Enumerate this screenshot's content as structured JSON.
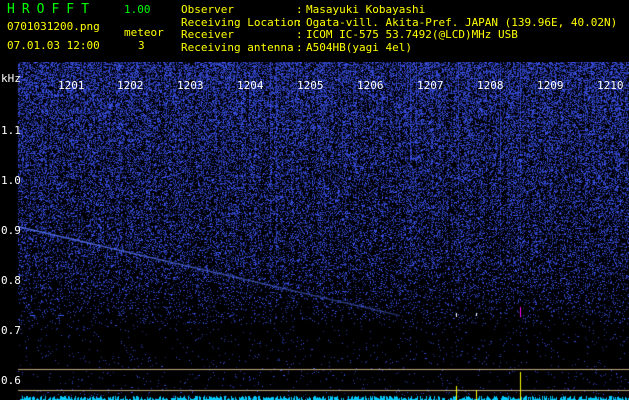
{
  "header": {
    "app_name": "HROFFT",
    "version": "1.00",
    "file_name": "0701031200.png",
    "datetime": "07.01.03 12:00",
    "meteor_label": "meteor",
    "meteor_count": "3"
  },
  "info": {
    "rows": [
      {
        "label": "Observer",
        "value": "Masayuki Kobayashi"
      },
      {
        "label": "Receiving Location",
        "value": "Ogata-vill. Akita-Pref. JAPAN (139.96E, 40.02N)"
      },
      {
        "label": "Receiver",
        "value": "ICOM IC-575 53.7492(@LCD)MHz USB"
      },
      {
        "label": "Receiving antenna",
        "value": "A504HB(yagi 4el)"
      }
    ]
  },
  "spectrogram": {
    "unit": "kHz",
    "y_ticks": [
      "1.1",
      "1.0",
      "0.9",
      "0.8",
      "0.7",
      "0.6"
    ],
    "x_ticks": [
      "1201",
      "1202",
      "1203",
      "1204",
      "1205",
      "1206",
      "1207",
      "1208",
      "1209",
      "1210"
    ],
    "colors": {
      "background": "#000000",
      "noise": "#2a3cff",
      "trace": "#3a5cff",
      "event": "#ff00ff",
      "guide": "#bfa980",
      "level": "#00ccff"
    }
  }
}
